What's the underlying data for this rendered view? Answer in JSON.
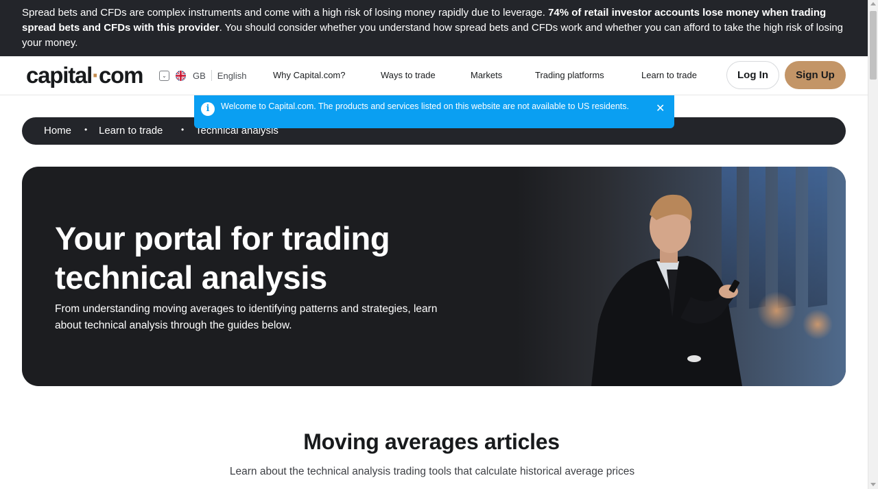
{
  "risk_banner": {
    "text_before": "Spread bets and CFDs are complex instruments and come with a high risk of losing money rapidly due to leverage. ",
    "text_bold": "74% of retail investor accounts lose money when trading spread bets and CFDs with this provider",
    "text_after": ". You should consider whether you understand how spread bets and CFDs work and whether you can afford to take the high risk of losing your money."
  },
  "header": {
    "logo_main": "capital",
    "logo_dot": "·",
    "logo_end": "com",
    "region_code": "GB",
    "language": "English",
    "nav": [
      "Why Capital.com?",
      "Ways to trade",
      "Markets",
      "Trading platforms",
      "Learn to trade"
    ],
    "login_label": "Log In",
    "signup_label": "Sign Up"
  },
  "notice": {
    "icon": "i",
    "message": "Welcome to Capital.com. The products and services listed on this website are not available to US residents.",
    "close": "✕"
  },
  "breadcrumb": [
    "Home",
    "Learn to trade",
    "Technical analysis"
  ],
  "breadcrumb_separator": "•",
  "hero": {
    "title": "Your portal for trading technical analysis",
    "description": "From understanding moving averages to identifying patterns and strategies, learn about technical analysis through the guides below."
  },
  "section": {
    "title": "Moving averages articles",
    "description": "Learn about the technical analysis trading tools that calculate historical average prices"
  },
  "colors": {
    "banner_bg": "#23252a",
    "accent_signup": "#c39567",
    "notice_bg": "#0a9ff2",
    "hero_bg": "#1c1d20"
  }
}
